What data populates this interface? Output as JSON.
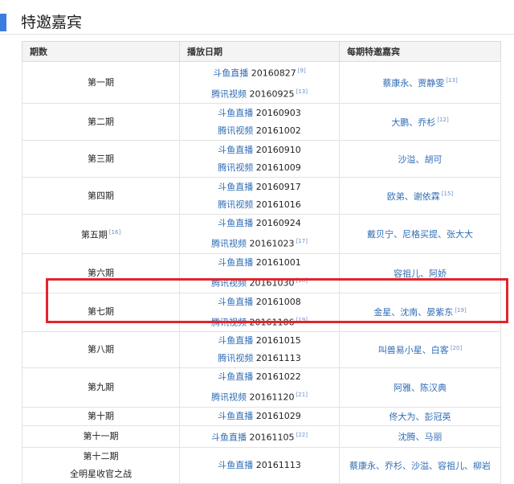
{
  "section": {
    "title": "特邀嘉宾"
  },
  "table": {
    "headers": [
      "期数",
      "播放日期",
      "每期特邀嘉宾"
    ],
    "rows": [
      {
        "episode": [
          "第一期"
        ],
        "ep_ref": "",
        "dates": [
          {
            "platform": "斗鱼直播",
            "date": "20160827",
            "ref": "[9]"
          },
          {
            "platform": "腾讯视频",
            "date": "20160925",
            "ref": "[13]"
          }
        ],
        "guests": "蔡康永、贾静雯",
        "guests_ref": "[13]"
      },
      {
        "episode": [
          "第二期"
        ],
        "ep_ref": "",
        "dates": [
          {
            "platform": "斗鱼直播",
            "date": "20160903",
            "ref": ""
          },
          {
            "platform": "腾讯视频",
            "date": "20161002",
            "ref": ""
          }
        ],
        "guests": "大鹏、乔杉",
        "guests_ref": "[12]"
      },
      {
        "episode": [
          "第三期"
        ],
        "ep_ref": "",
        "dates": [
          {
            "platform": "斗鱼直播",
            "date": "20160910",
            "ref": ""
          },
          {
            "platform": "腾讯视频",
            "date": "20161009",
            "ref": ""
          }
        ],
        "guests": "沙溢、胡可",
        "guests_ref": ""
      },
      {
        "episode": [
          "第四期"
        ],
        "ep_ref": "",
        "dates": [
          {
            "platform": "斗鱼直播",
            "date": "20160917",
            "ref": ""
          },
          {
            "platform": "腾讯视频",
            "date": "20161016",
            "ref": ""
          }
        ],
        "guests": "欧弟、谢依霖",
        "guests_ref": "[15]"
      },
      {
        "episode": [
          "第五期"
        ],
        "ep_ref": "[16]",
        "dates": [
          {
            "platform": "斗鱼直播",
            "date": "20160924",
            "ref": ""
          },
          {
            "platform": "腾讯视频",
            "date": "20161023",
            "ref": "[17]"
          }
        ],
        "guests": "戴贝宁、尼格买提、张大大",
        "guests_ref": ""
      },
      {
        "episode": [
          "第六期"
        ],
        "ep_ref": "",
        "dates": [
          {
            "platform": "斗鱼直播",
            "date": "20161001",
            "ref": ""
          },
          {
            "platform": "腾讯视频",
            "date": "20161030",
            "ref": "[18]"
          }
        ],
        "guests": "容祖儿、阿娇",
        "guests_ref": ""
      },
      {
        "episode": [
          "第七期"
        ],
        "ep_ref": "",
        "dates": [
          {
            "platform": "斗鱼直播",
            "date": "20161008",
            "ref": ""
          },
          {
            "platform": "腾讯视频",
            "date": "20161106",
            "ref": "[19]"
          }
        ],
        "guests": "金星、沈南、晏紫东",
        "guests_ref": "[19]"
      },
      {
        "episode": [
          "第八期"
        ],
        "ep_ref": "",
        "dates": [
          {
            "platform": "斗鱼直播",
            "date": "20161015",
            "ref": ""
          },
          {
            "platform": "腾讯视频",
            "date": "20161113",
            "ref": ""
          }
        ],
        "guests": "叫兽易小星、白客",
        "guests_ref": "[20]"
      },
      {
        "episode": [
          "第九期"
        ],
        "ep_ref": "",
        "dates": [
          {
            "platform": "斗鱼直播",
            "date": "20161022",
            "ref": ""
          },
          {
            "platform": "腾讯视频",
            "date": "20161120",
            "ref": "[21]"
          }
        ],
        "guests": "阿雅、陈汉典",
        "guests_ref": ""
      },
      {
        "episode": [
          "第十期"
        ],
        "ep_ref": "",
        "dates": [
          {
            "platform": "斗鱼直播",
            "date": "20161029",
            "ref": ""
          }
        ],
        "guests": "佟大为、彭冠英",
        "guests_ref": ""
      },
      {
        "episode": [
          "第十一期"
        ],
        "ep_ref": "",
        "dates": [
          {
            "platform": "斗鱼直播",
            "date": "20161105",
            "ref": "[22]"
          }
        ],
        "guests": "沈腾、马丽",
        "guests_ref": ""
      },
      {
        "episode": [
          "第十二期",
          "全明星收官之战"
        ],
        "ep_ref": "",
        "dates": [
          {
            "platform": "斗鱼直播",
            "date": "20161113",
            "ref": ""
          }
        ],
        "guests": "蔡康永、乔杉、沙溢、容祖儿、柳岩",
        "guests_ref": ""
      }
    ]
  },
  "highlight": {
    "row": "第七期",
    "color": "#e0252b"
  }
}
